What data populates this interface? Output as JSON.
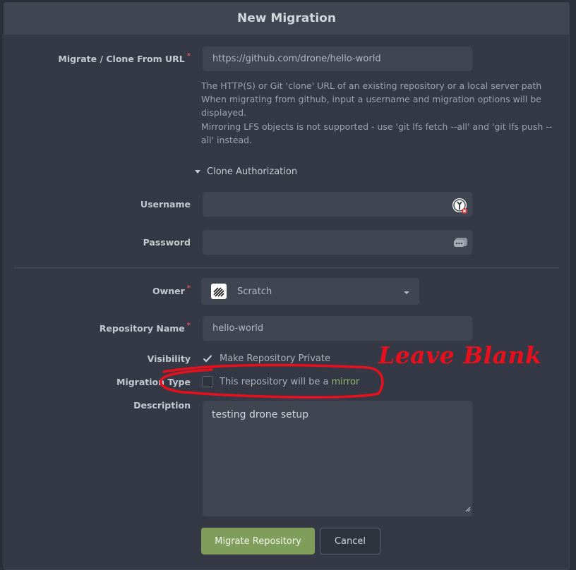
{
  "title": "New Migration",
  "form": {
    "clone_url": {
      "label": "Migrate / Clone From URL",
      "required_marker": "*",
      "value": "https://github.com/drone/hello-world"
    },
    "help_lines": [
      "The HTTP(S) or Git 'clone' URL of an existing repository or a local server path",
      "When migrating from github, input a username and migration options will be displayed.",
      "Mirroring LFS objects is not supported - use 'git lfs fetch --all' and 'git lfs push --all' instead."
    ],
    "clone_authorization": {
      "label": "Clone Authorization",
      "username_label": "Username",
      "username_value": "",
      "password_label": "Password",
      "password_value": ""
    },
    "owner": {
      "label": "Owner",
      "required_marker": "*",
      "selected": "Scratch"
    },
    "repository_name": {
      "label": "Repository Name",
      "required_marker": "*",
      "value": "hello-world"
    },
    "visibility": {
      "label": "Visibility",
      "checkbox_label": "Make Repository Private",
      "checked": true
    },
    "migration_type": {
      "label": "Migration Type",
      "checkbox_label": "This repository will be a",
      "link_text": "mirror",
      "checked": false
    },
    "description": {
      "label": "Description",
      "value": "testing drone setup"
    },
    "buttons": {
      "migrate": "Migrate Repository",
      "cancel": "Cancel"
    }
  },
  "annotation": {
    "text": "Leave Blank",
    "color": "#e8101c"
  },
  "colors": {
    "background": "#2b2f37",
    "panel": "#353945",
    "input": "#404552",
    "primary_button": "#7f9e5c",
    "link": "#8fb86c",
    "required": "#e05252"
  }
}
